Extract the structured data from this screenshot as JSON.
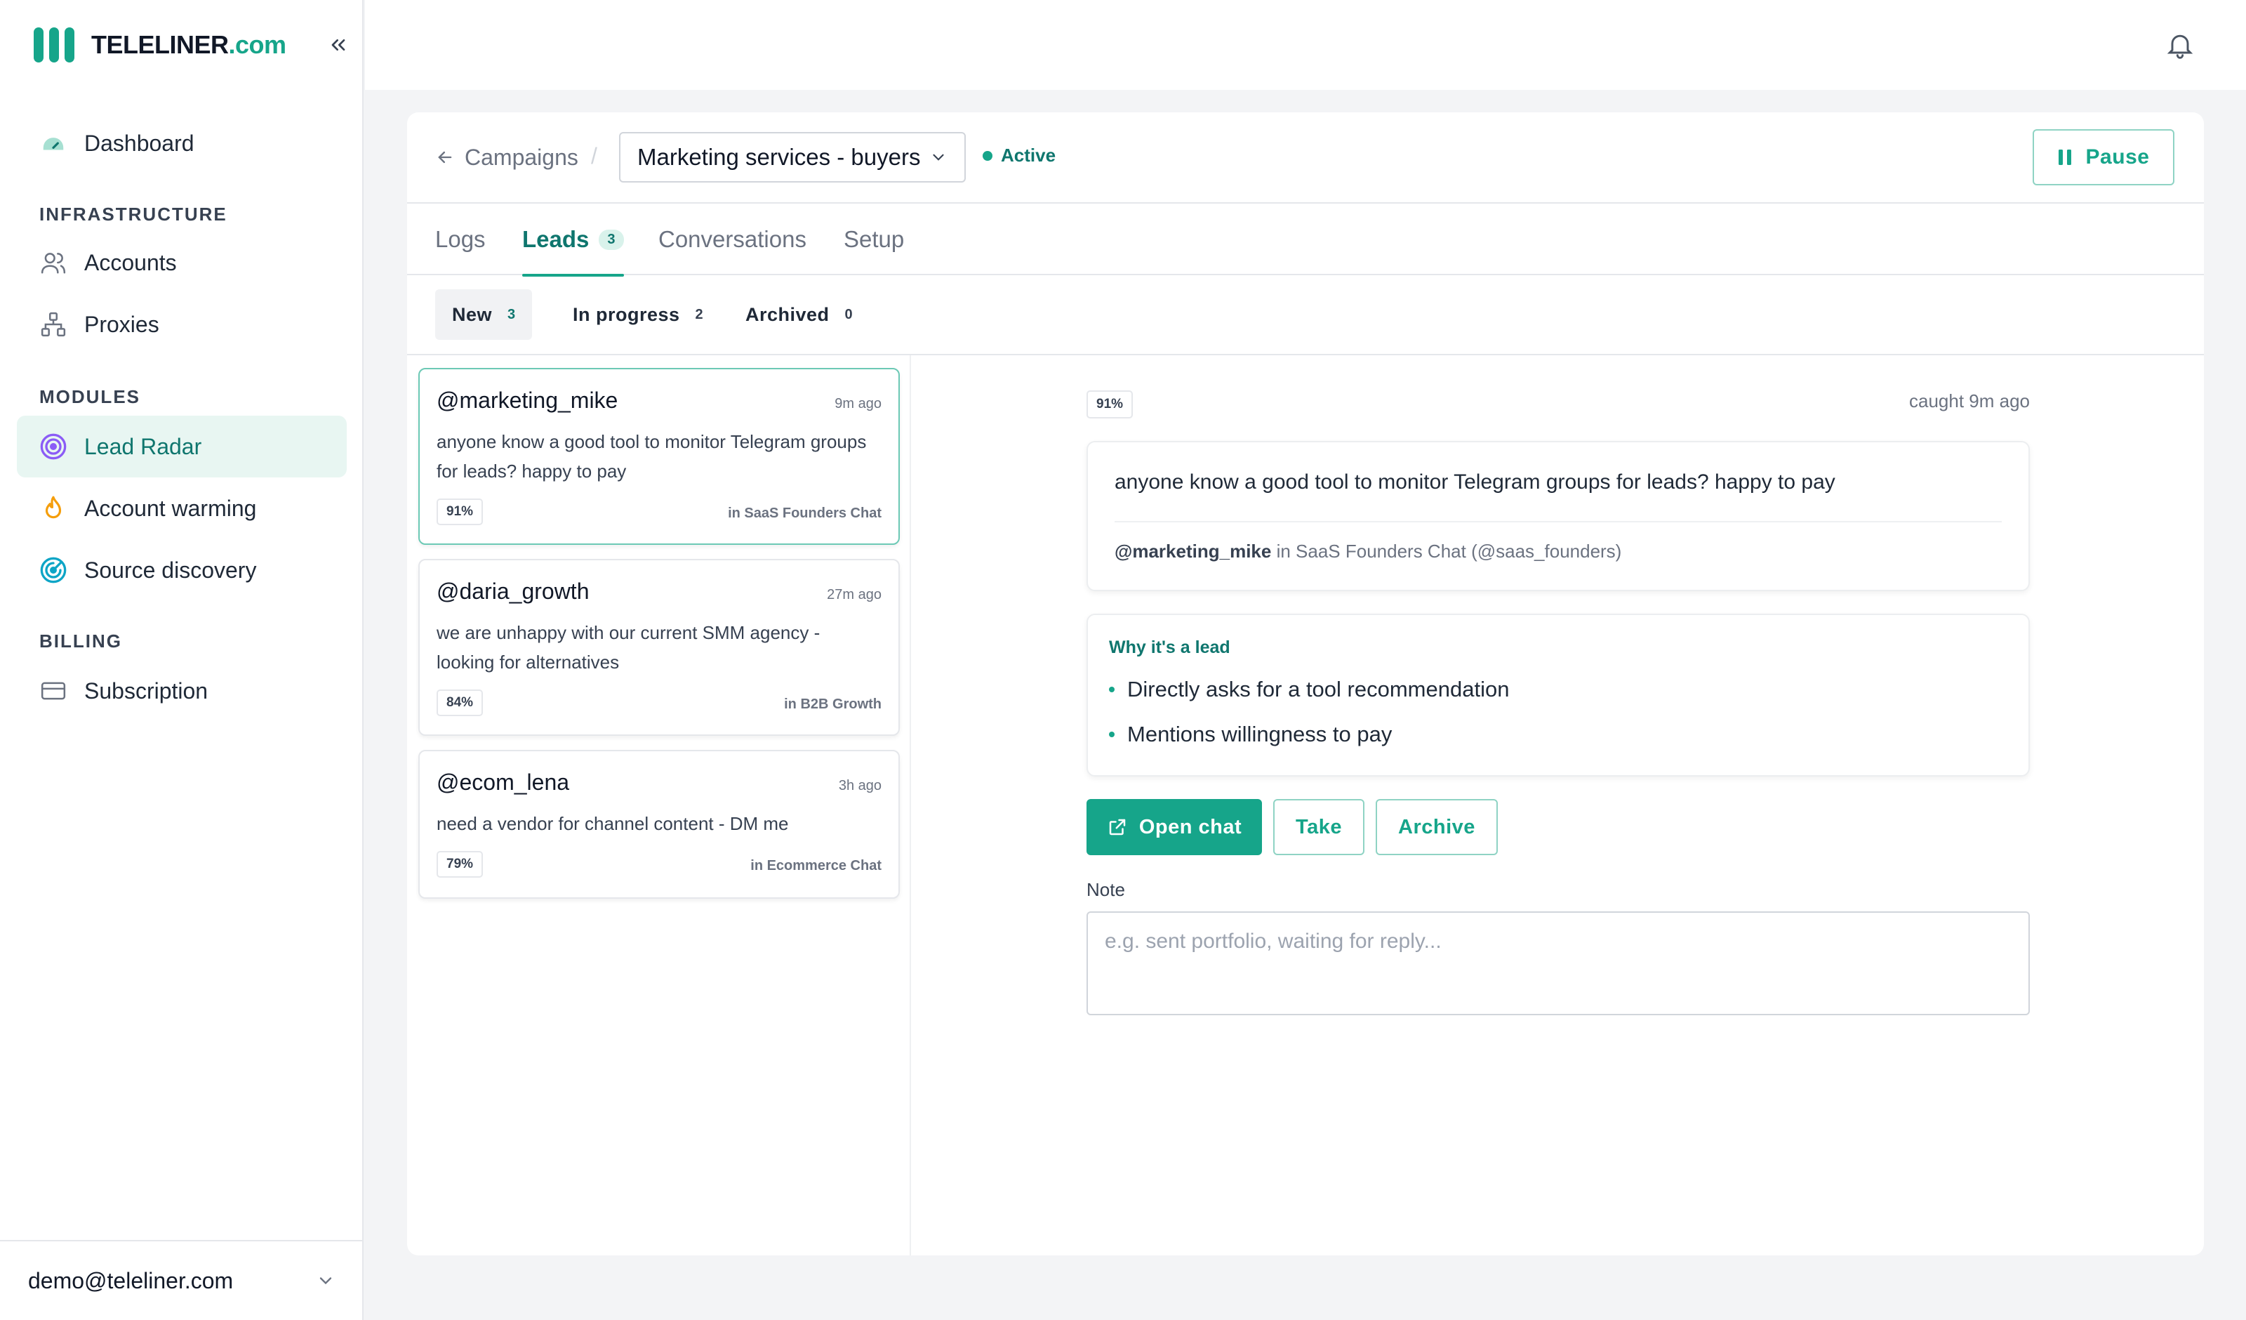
{
  "app": {
    "logo_name": "TELELINER",
    "logo_suffix": ".com",
    "user_email": "demo@teleliner.com"
  },
  "sidebar": {
    "dashboard": "Dashboard",
    "sections": {
      "infrastructure": "INFRASTRUCTURE",
      "modules": "MODULES",
      "billing": "BILLING"
    },
    "items": {
      "accounts": "Accounts",
      "proxies": "Proxies",
      "lead_radar": "Lead Radar",
      "account_warming": "Account warming",
      "source_discovery": "Source discovery",
      "subscription": "Subscription"
    },
    "active": "lead_radar"
  },
  "header": {
    "back_label": "Campaigns",
    "separator": "/",
    "campaign": "Marketing services - buyers",
    "status": "Active",
    "pause_label": "Pause"
  },
  "tabs": [
    {
      "label": "Logs"
    },
    {
      "label": "Leads",
      "badge": "3",
      "active": true
    },
    {
      "label": "Conversations"
    },
    {
      "label": "Setup"
    }
  ],
  "filters": [
    {
      "label": "New",
      "count": "3",
      "active": true
    },
    {
      "label": "In progress",
      "count": "2"
    },
    {
      "label": "Archived",
      "count": "0"
    }
  ],
  "leads": [
    {
      "handle": "@marketing_mike",
      "time": "9m ago",
      "message": "anyone know a good tool to monitor Telegram groups for leads? happy to pay",
      "score": "91%",
      "source": "in SaaS Founders Chat",
      "selected": true
    },
    {
      "handle": "@daria_growth",
      "time": "27m ago",
      "message": "we are unhappy with our current SMM agency - looking for alternatives",
      "score": "84%",
      "source": "in B2B Growth"
    },
    {
      "handle": "@ecom_lena",
      "time": "3h ago",
      "message": "need a vendor for channel content - DM me",
      "score": "79%",
      "source": "in Ecommerce Chat"
    }
  ],
  "detail": {
    "score": "91%",
    "caught": "caught 9m ago",
    "message": "anyone know a good tool to monitor Telegram groups for leads? happy to pay",
    "author": "@marketing_mike",
    "context": "in SaaS Founders Chat (@saas_founders)",
    "why_title": "Why it's a lead",
    "reasons": [
      "Directly asks for a tool recommendation",
      "Mentions willingness to pay"
    ],
    "actions": {
      "open_chat": "Open chat",
      "take": "Take",
      "archive": "Archive"
    },
    "note_label": "Note",
    "note_placeholder": "e.g. sent portfolio, waiting for reply...",
    "note_value": ""
  },
  "colors": {
    "accent": "#16a58a",
    "accent_dark": "#0f766e",
    "active_bg": "#e8f6f2"
  }
}
